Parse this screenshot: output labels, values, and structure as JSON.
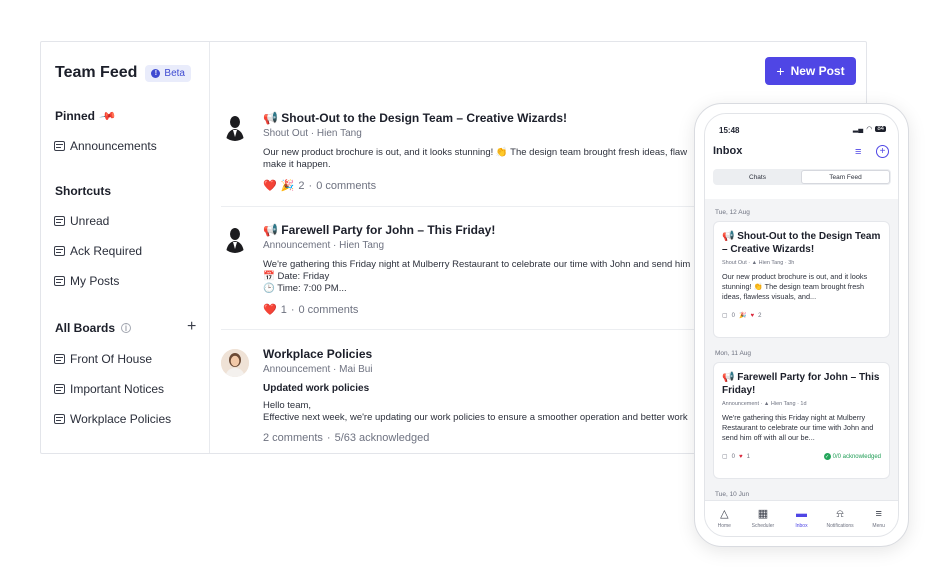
{
  "sidebar": {
    "title": "Team Feed",
    "badge": "Beta",
    "pinned": "Pinned",
    "pinned_items": [
      "Announcements"
    ],
    "shortcuts": "Shortcuts",
    "shortcut_items": [
      "Unread",
      "Ack Required",
      "My Posts"
    ],
    "all_boards": "All Boards",
    "board_items": [
      "Front Of House",
      "Important Notices",
      "Workplace Policies"
    ]
  },
  "header": {
    "new_post": "New Post"
  },
  "posts": [
    {
      "title": "Shout-Out to the Design Team – Creative Wizards!",
      "type": "Shout Out",
      "author": "Hien Tang",
      "text1": "Our new product brochure is out, and it looks stunning! 👏 The design team brought fresh ideas, flaw",
      "text2": "make it happen.",
      "reactions": "2",
      "comments": "0 comments"
    },
    {
      "title": "Farewell Party for John – This Friday!",
      "type": "Announcement",
      "author": "Hien Tang",
      "text1": "We're gathering this Friday night at Mulberry Restaurant to celebrate our time with John and send him",
      "text2": "Date: Friday",
      "text3": "Time: 7:00 PM...",
      "reactions": "1",
      "comments": "0 comments"
    },
    {
      "title": "Workplace Policies",
      "type": "Announcement",
      "author": "Mai Bui",
      "subtitle": "Updated work policies",
      "text1": "Hello team,",
      "text2": "Effective next week, we're updating our work policies to ensure a smoother operation and better work",
      "comments": "2 comments",
      "acknowledged": "5/63 acknowledged"
    }
  ],
  "phone": {
    "time": "15:48",
    "battery": "84",
    "inbox": "Inbox",
    "seg_chats": "Chats",
    "seg_feed": "Team Feed",
    "date1": "Tue, 12 Aug",
    "card1_title": "Shout-Out to the Design Team – Creative Wizards!",
    "card1_meta_type": "Shout Out",
    "card1_meta_author": "Hien Tang · 3h",
    "card1_text": "Our new product brochure is out, and it looks stunning! 👏 The design team brought fresh ideas, flawless visuals, and...",
    "card1_comments": "0",
    "card1_reacts": "2",
    "date2": "Mon, 11 Aug",
    "card2_title": "Farewell Party for John – This Friday!",
    "card2_meta_type": "Announcement",
    "card2_meta_author": "Hien Tang · 1d",
    "card2_text": "We're gathering this Friday night at Mulberry Restaurant to celebrate our time with John and send him off with all our be...",
    "card2_comments": "0",
    "card2_reacts": "1",
    "card2_ack": "0/0 acknowledged",
    "date3": "Tue, 10 Jun",
    "tabs": [
      "Home",
      "Scheduler",
      "Inbox",
      "Notifications",
      "Menu"
    ]
  },
  "colors": {
    "accent": "#4f46e5",
    "heart": "#d9263a",
    "ack": "#22a55a"
  }
}
